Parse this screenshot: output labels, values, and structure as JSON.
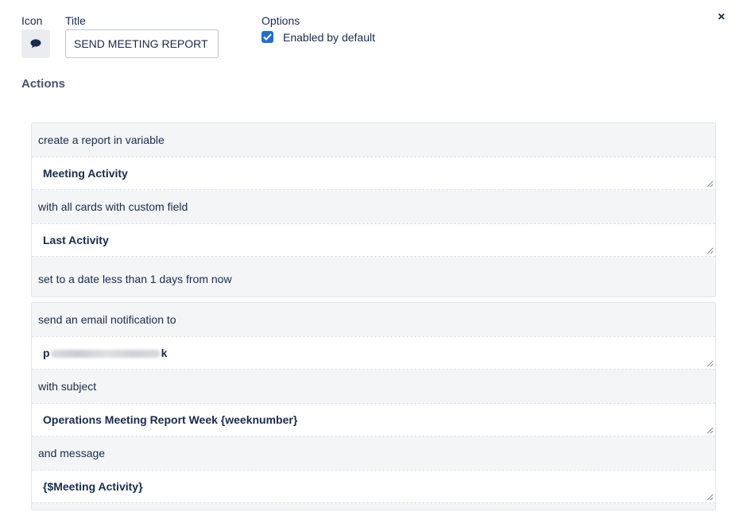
{
  "header": {
    "icon_label": "Icon",
    "title_label": "Title",
    "title_value": "SEND MEETING REPORT",
    "options_label": "Options",
    "enabled_label": "Enabled by default",
    "enabled_checked": true,
    "close_glyph": "×"
  },
  "actions": {
    "heading": "Actions",
    "groups": [
      {
        "rows": [
          {
            "label": "create a report in variable"
          },
          {
            "field": "Meeting Activity"
          },
          {
            "label": "with all cards with custom field"
          },
          {
            "field": "Last Activity"
          },
          {
            "label": "set to a date less than 1 days from now"
          }
        ]
      },
      {
        "rows": [
          {
            "label": "send an email notification to"
          },
          {
            "field_start": "p",
            "field_end": "k",
            "field_redacted": true
          },
          {
            "label": "with subject"
          },
          {
            "field": "Operations Meeting Report Week {weeknumber}"
          },
          {
            "label": "and message"
          },
          {
            "field": "{$Meeting Activity}"
          }
        ]
      }
    ]
  },
  "icons": {
    "card_icon": "comment-icon",
    "checkbox": "check-icon",
    "close": "close-icon",
    "resize": "resize-grip-icon"
  },
  "colors": {
    "checkbox": "#1f6fd1",
    "card_bg": "#f4f5f7",
    "text": "#172b4d"
  }
}
